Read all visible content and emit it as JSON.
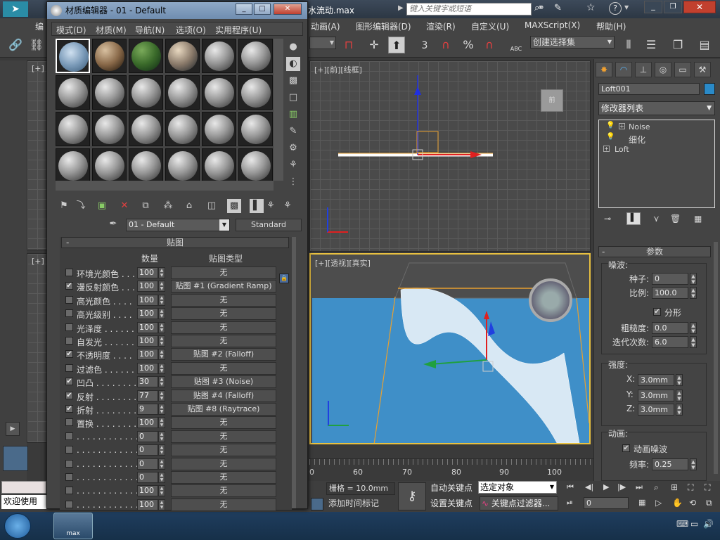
{
  "app": {
    "file_title": "水流动.max",
    "search_placeholder": "键入关键字或短语"
  },
  "menubar": {
    "items": [
      "编",
      "动画(A)",
      "图形编辑器(D)",
      "渲染(R)",
      "自定义(U)",
      "MAXScript(X)",
      "帮助(H)"
    ]
  },
  "toolbar": {
    "selection_set": "创建选择集",
    "snap_label": "3",
    "percent_label": "%",
    "abc_label": "ABC"
  },
  "viewports": {
    "top_left_label": "[+]",
    "front_label": "[+][前][线框]",
    "bottom_left_label": "[+]",
    "persp_label": "[+][透视][真实]",
    "timeline_ticks": [
      "0",
      "60",
      "70",
      "80",
      "90",
      "100"
    ],
    "gizmo_label": "前"
  },
  "matedit": {
    "title": "材质编辑器 - 01 - Default",
    "menu": [
      "模式(D)",
      "材质(M)",
      "导航(N)",
      "选项(O)",
      "实用程序(U)"
    ],
    "material_name": "01 - Default",
    "material_type": "Standard",
    "rollout_title": "贴图",
    "col_amount": "数量",
    "col_maptype": "贴图类型",
    "maps": [
      {
        "name": "环境光颜色 . . .",
        "checked": false,
        "amount": "100",
        "map": "无"
      },
      {
        "name": "漫反射颜色 . . .",
        "checked": true,
        "amount": "100",
        "map": "贴图 #1 (Gradient Ramp)"
      },
      {
        "name": "高光颜色 . . . .",
        "checked": false,
        "amount": "100",
        "map": "无"
      },
      {
        "name": "高光级别 . . . .",
        "checked": false,
        "amount": "100",
        "map": "无"
      },
      {
        "name": "光泽度 . . . . . .",
        "checked": false,
        "amount": "100",
        "map": "无"
      },
      {
        "name": "自发光 . . . . . .",
        "checked": false,
        "amount": "100",
        "map": "无"
      },
      {
        "name": "不透明度 . . . .",
        "checked": true,
        "amount": "100",
        "map": "贴图 #2 (Falloff)"
      },
      {
        "name": "过滤色 . . . . . .",
        "checked": false,
        "amount": "100",
        "map": "无"
      },
      {
        "name": "凹凸 . . . . . . . .",
        "checked": true,
        "amount": "30",
        "map": "贴图 #3 (Noise)"
      },
      {
        "name": "反射 . . . . . . . .",
        "checked": true,
        "amount": "77",
        "map": "贴图 #4 (Falloff)"
      },
      {
        "name": "折射 . . . . . . . .",
        "checked": true,
        "amount": "9",
        "map": "贴图 #8 (Raytrace)"
      },
      {
        "name": "置换 . . . . . . . .",
        "checked": false,
        "amount": "100",
        "map": "无"
      },
      {
        "name": ". . . . . . . . . . . .",
        "checked": false,
        "amount": "0",
        "map": "无"
      },
      {
        "name": ". . . . . . . . . . . .",
        "checked": false,
        "amount": "0",
        "map": "无"
      },
      {
        "name": ". . . . . . . . . . . .",
        "checked": false,
        "amount": "0",
        "map": "无"
      },
      {
        "name": ". . . . . . . . . . . .",
        "checked": false,
        "amount": "0",
        "map": "无"
      },
      {
        "name": ". . . . . . . . . . . .",
        "checked": false,
        "amount": "100",
        "map": "无"
      },
      {
        "name": ". . . . . . . . . . . .",
        "checked": false,
        "amount": "100",
        "map": "无"
      }
    ]
  },
  "cmdpanel": {
    "object_name": "Loft001",
    "modifier_list": "修改器列表",
    "stack": [
      "Noise",
      "细化",
      "Loft"
    ],
    "params_title": "参数",
    "noise_group": "噪波:",
    "seed_label": "种子:",
    "seed": "0",
    "scale_label": "比例:",
    "scale": "100.0",
    "fractal_label": "分形",
    "roughness_label": "粗糙度:",
    "roughness": "0.0",
    "iterations_label": "迭代次数:",
    "iterations": "6.0",
    "strength_group": "强度:",
    "x_label": "X:",
    "x": "3.0mm",
    "y_label": "Y:",
    "y": "3.0mm",
    "z_label": "Z:",
    "z": "3.0mm",
    "anim_group": "动画:",
    "anim_noise_label": "动画噪波",
    "freq_label": "频率:",
    "freq": "0.25"
  },
  "bottom": {
    "welcome": "欢迎使用",
    "grid": "栅格 = 10.0mm",
    "add_time_tag": "添加时间标记",
    "auto_key": "自动关键点",
    "set_key": "设置关键点",
    "selected_object": "选定对象",
    "key_filters": "关键点过滤器...",
    "frame": "0"
  },
  "taskbar": {
    "app_label": "max"
  }
}
